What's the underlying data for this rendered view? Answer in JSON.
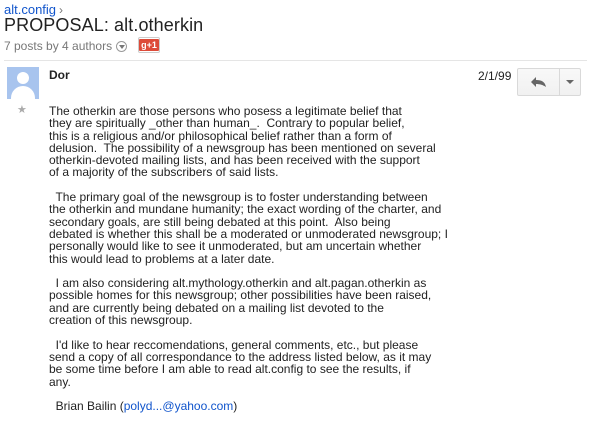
{
  "breadcrumb": {
    "group": "alt.config",
    "separator": "›"
  },
  "thread": {
    "title": "PROPOSAL: alt.otherkin",
    "meta": "7 posts by 4 authors",
    "gplus_label": "g+1"
  },
  "post": {
    "author": "Dor",
    "date": "2/1/99",
    "paragraphs": [
      "The otherkin are those persons who posess a legitimate belief that\nthey are spiritually _other than human_.  Contrary to popular belief,\nthis is a religious and/or philosophical belief rather than a form of\ndelusion.  The possibility of a newsgroup has been mentioned on several\notherkin-devoted mailing lists, and has been received with the support\nof a majority of the subscribers of said lists.",
      "  The primary goal of the newsgroup is to foster understanding between\nthe otherkin and mundane humanity; the exact wording of the charter, and\nsecondary goals, are still being debated at this point.  Also being\ndebated is whether this shall be a moderated or unmoderated newsgroup; I\npersonally would like to see it unmoderated, but am uncertain whether\nthis would lead to problems at a later date.",
      "  I am also considering alt.mythology.otherkin and alt.pagan.otherkin as\npossible homes for this newsgroup; other possibilities have been raised,\nand are currently being debated on a mailing list devoted to the\ncreation of this newsgroup.",
      "  I'd like to hear reccomendations, general comments, etc., but please\nsend a copy of all correspondance to the address listed below, as it may\nbe some time before I am able to read alt.config to see the results, if\nany."
    ],
    "signature_name": "  Brian Bailin (",
    "signature_email": "polyd...@yahoo.com",
    "signature_close": ")"
  },
  "icons": [
    "person-avatar-icon",
    "star-icon",
    "reply-icon",
    "dropdown-caret-icon",
    "gplus-icon"
  ]
}
